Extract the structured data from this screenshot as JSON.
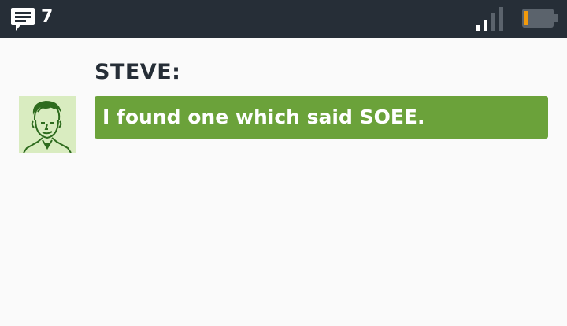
{
  "status_bar": {
    "message_icon": "chat-bubble-icon",
    "message_count": "7",
    "signal_icon": "signal-strength-icon",
    "signal_level": 0.5,
    "battery_icon": "battery-icon",
    "battery_level": 0.1,
    "battery_color": "#f29a0c"
  },
  "dialogue": {
    "speaker": "STEVE:",
    "message": "I found one which said SOEE.",
    "avatar_icon": "steve-portrait-icon"
  },
  "colors": {
    "bar": "#262e37",
    "bubble": "#6ba23a",
    "avatar_bg": "#d9ecc0",
    "avatar_ink": "#2e6b1e"
  }
}
